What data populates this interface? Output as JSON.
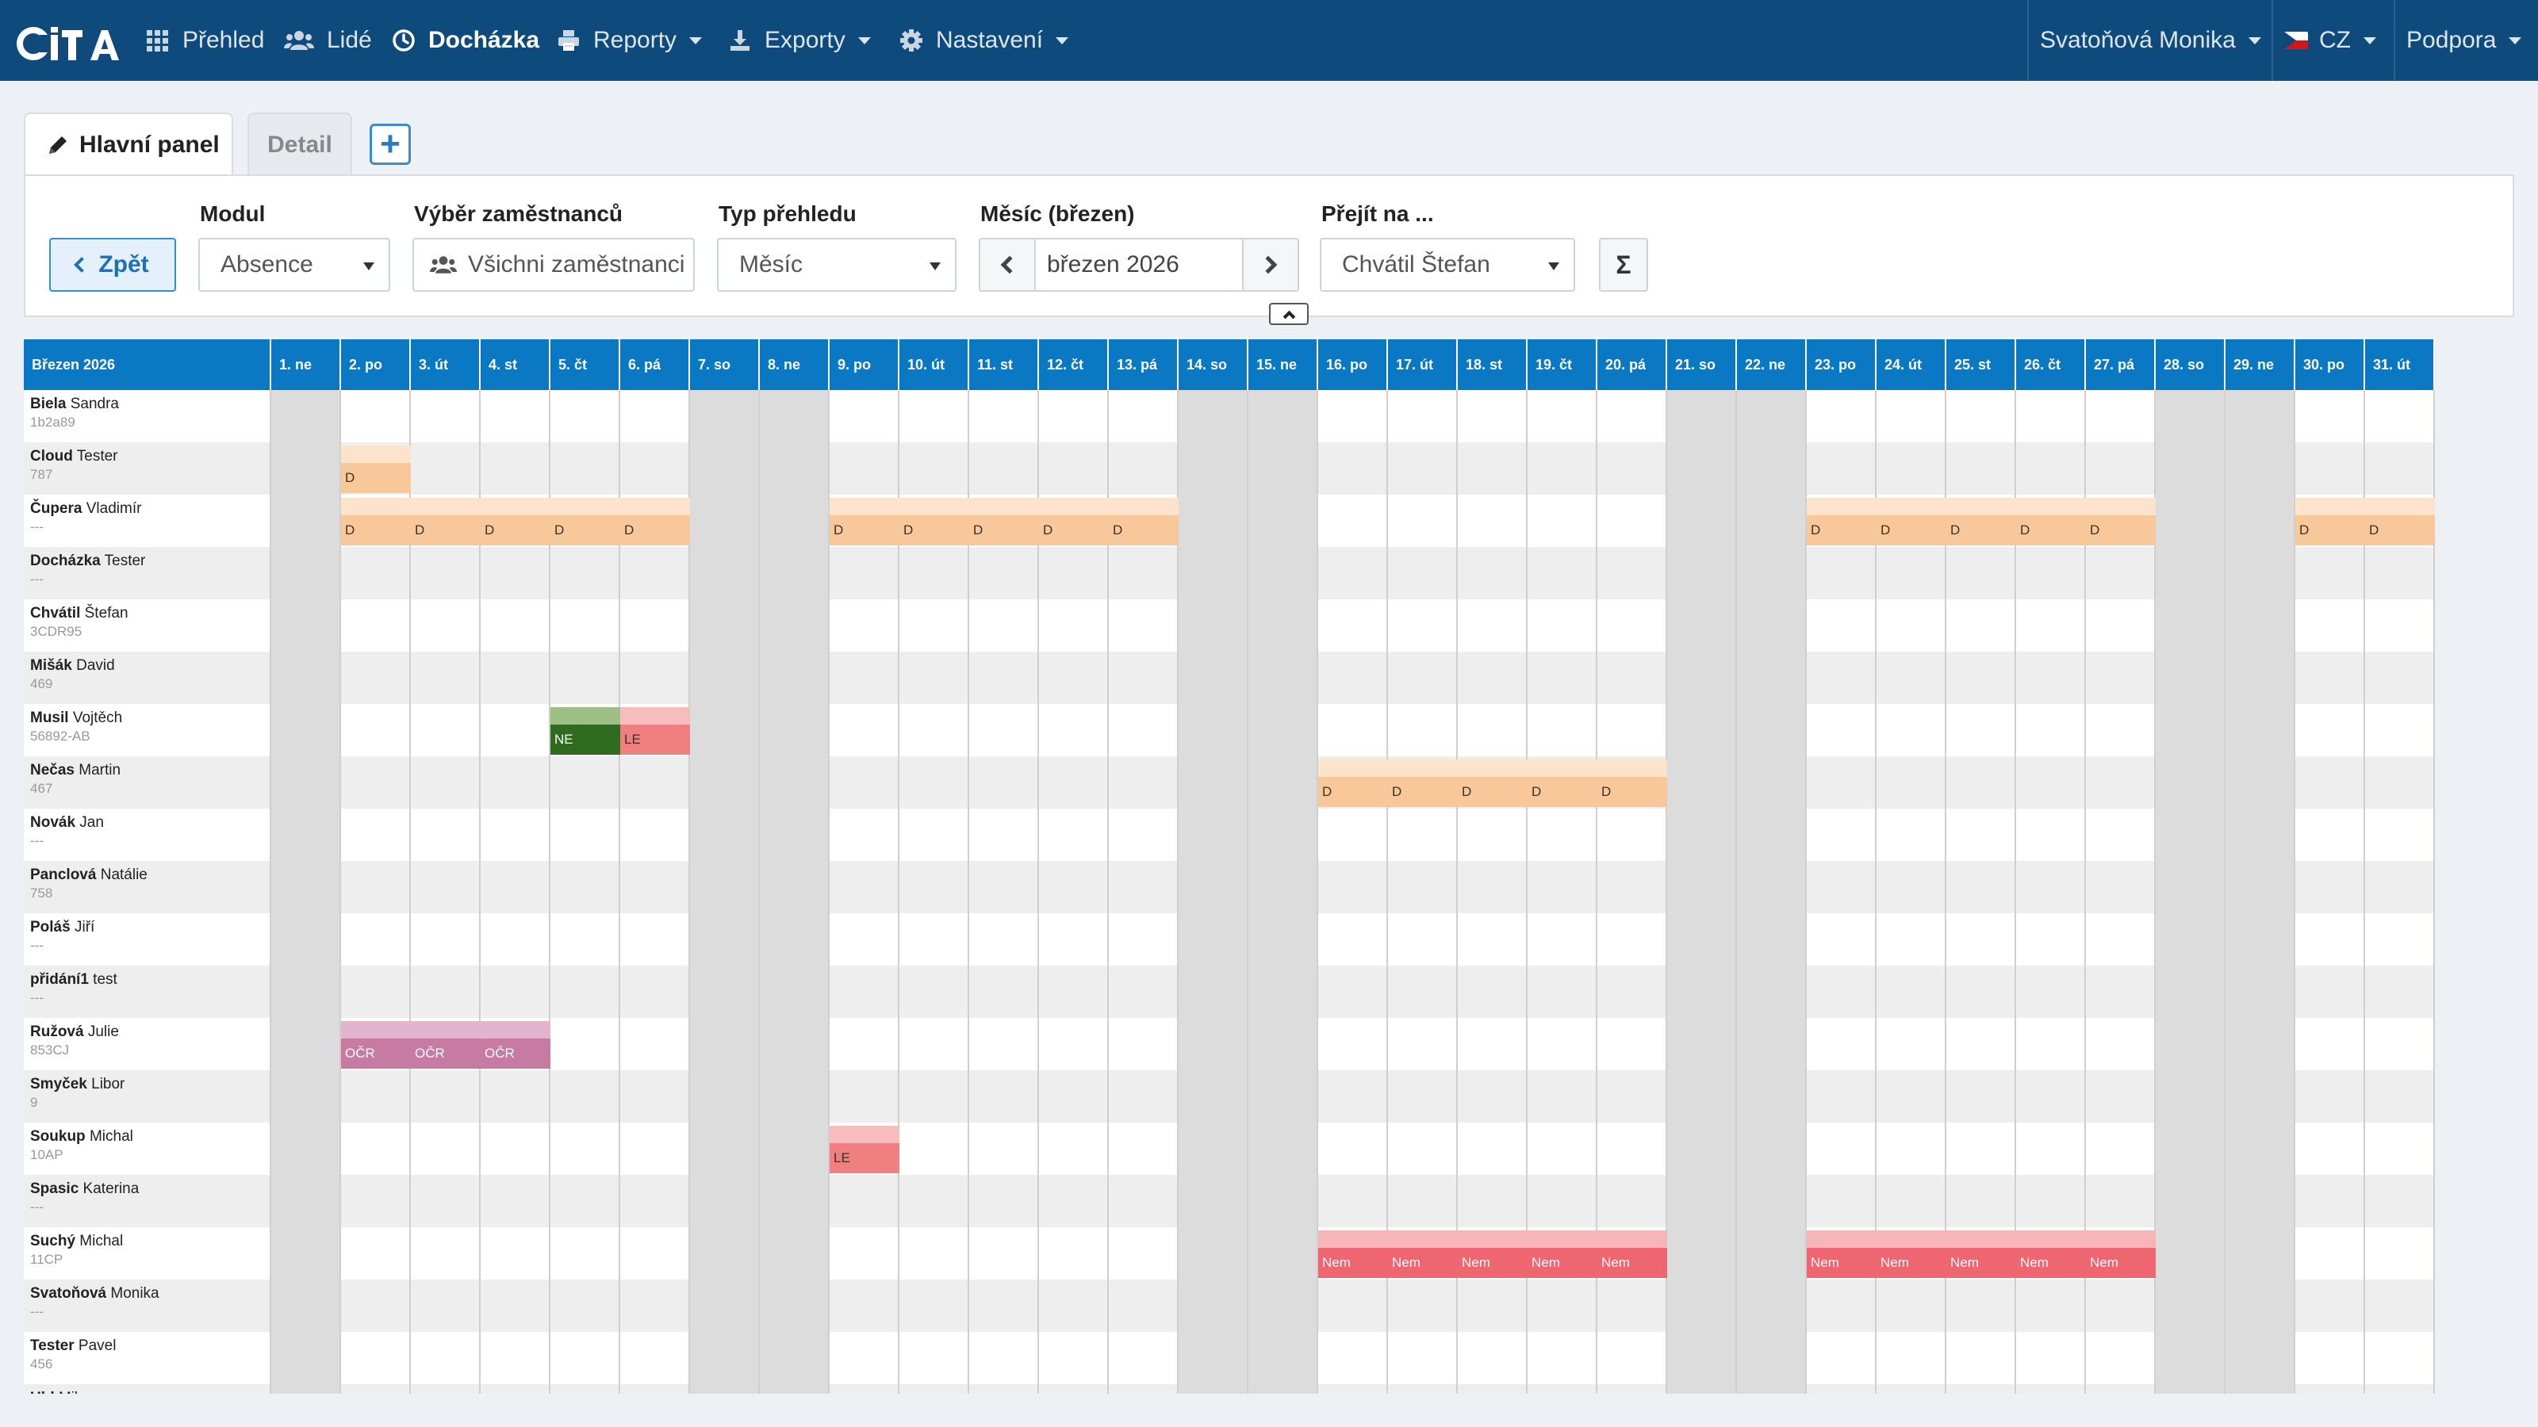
{
  "app": {
    "logo_text": "CITA",
    "brand_color": "#0f4a7c"
  },
  "nav": {
    "items": [
      {
        "label": "Přehled",
        "icon": "grid-icon",
        "active": false,
        "dropdown": false
      },
      {
        "label": "Lidé",
        "icon": "users-icon",
        "active": false,
        "dropdown": false
      },
      {
        "label": "Docházka",
        "icon": "clock-icon",
        "active": true,
        "dropdown": false
      },
      {
        "label": "Reporty",
        "icon": "print-icon",
        "active": false,
        "dropdown": true
      },
      {
        "label": "Exporty",
        "icon": "export-icon",
        "active": false,
        "dropdown": true
      },
      {
        "label": "Nastavení",
        "icon": "gear-icon",
        "active": false,
        "dropdown": true
      }
    ],
    "user": "Svatoňová Monika",
    "language": "CZ",
    "support": "Podpora"
  },
  "tabs": {
    "main": "Hlavní panel",
    "detail": "Detail",
    "add": "+"
  },
  "filters": {
    "back": "Zpět",
    "module_label": "Modul",
    "module_value": "Absence",
    "employees_label": "Výběr zaměstnanců",
    "employees_value": "Všichni zaměstnanci",
    "view_label": "Typ přehledu",
    "view_value": "Měsíc",
    "month_label": "Měsíc (březen)",
    "month_value": "březen 2026",
    "goto_label": "Přejít na ...",
    "goto_value": "Chvátil Štefan",
    "sum_button": "Σ"
  },
  "calendar": {
    "title": "Březen 2026",
    "days": [
      {
        "label": "1. ne",
        "weekend": true
      },
      {
        "label": "2. po",
        "weekend": false
      },
      {
        "label": "3. út",
        "weekend": false
      },
      {
        "label": "4. st",
        "weekend": false
      },
      {
        "label": "5. čt",
        "weekend": false
      },
      {
        "label": "6. pá",
        "weekend": false
      },
      {
        "label": "7. so",
        "weekend": true
      },
      {
        "label": "8. ne",
        "weekend": true
      },
      {
        "label": "9. po",
        "weekend": false
      },
      {
        "label": "10. út",
        "weekend": false
      },
      {
        "label": "11. st",
        "weekend": false
      },
      {
        "label": "12. čt",
        "weekend": false
      },
      {
        "label": "13. pá",
        "weekend": false
      },
      {
        "label": "14. so",
        "weekend": true
      },
      {
        "label": "15. ne",
        "weekend": true
      },
      {
        "label": "16. po",
        "weekend": false
      },
      {
        "label": "17. út",
        "weekend": false
      },
      {
        "label": "18. st",
        "weekend": false
      },
      {
        "label": "19. čt",
        "weekend": false
      },
      {
        "label": "20. pá",
        "weekend": false
      },
      {
        "label": "21. so",
        "weekend": true
      },
      {
        "label": "22. ne",
        "weekend": true
      },
      {
        "label": "23. po",
        "weekend": false
      },
      {
        "label": "24. út",
        "weekend": false
      },
      {
        "label": "25. st",
        "weekend": false
      },
      {
        "label": "26. čt",
        "weekend": false
      },
      {
        "label": "27. pá",
        "weekend": false
      },
      {
        "label": "28. so",
        "weekend": true
      },
      {
        "label": "29. ne",
        "weekend": true
      },
      {
        "label": "30. po",
        "weekend": false
      },
      {
        "label": "31. út",
        "weekend": false
      }
    ],
    "absence_types": {
      "D": {
        "top": "#fbe3cc",
        "bottom": "#f8c89a",
        "text": "#333333"
      },
      "NE": {
        "top": "#9dbf86",
        "bottom": "#2e6b1e",
        "text": "#ffffff"
      },
      "LE": {
        "top": "#f7bcbc",
        "bottom": "#f07f80",
        "text": "#333333"
      },
      "OČR": {
        "top": "#e2b4cd",
        "bottom": "#c77aa2",
        "text": "#ffffff"
      },
      "Nem": {
        "top": "#f5b5b9",
        "bottom": "#ee6670",
        "text": "#ffffff"
      }
    },
    "employees": [
      {
        "surname": "Biela",
        "firstname": "Sandra",
        "code": "1b2a89",
        "absences": []
      },
      {
        "surname": "Cloud",
        "firstname": "Tester",
        "code": "787",
        "absences": [
          {
            "day": 2,
            "type": "D"
          }
        ]
      },
      {
        "surname": "Čupera",
        "firstname": "Vladimír",
        "code": "---",
        "absences": [
          {
            "day": 2,
            "type": "D"
          },
          {
            "day": 3,
            "type": "D"
          },
          {
            "day": 4,
            "type": "D"
          },
          {
            "day": 5,
            "type": "D"
          },
          {
            "day": 6,
            "type": "D"
          },
          {
            "day": 9,
            "type": "D"
          },
          {
            "day": 10,
            "type": "D"
          },
          {
            "day": 11,
            "type": "D"
          },
          {
            "day": 12,
            "type": "D"
          },
          {
            "day": 13,
            "type": "D"
          },
          {
            "day": 23,
            "type": "D"
          },
          {
            "day": 24,
            "type": "D"
          },
          {
            "day": 25,
            "type": "D"
          },
          {
            "day": 26,
            "type": "D"
          },
          {
            "day": 27,
            "type": "D"
          },
          {
            "day": 30,
            "type": "D"
          },
          {
            "day": 31,
            "type": "D"
          }
        ]
      },
      {
        "surname": "Docházka",
        "firstname": "Tester",
        "code": "---",
        "absences": []
      },
      {
        "surname": "Chvátil",
        "firstname": "Štefan",
        "code": "3CDR95",
        "absences": []
      },
      {
        "surname": "Mišák",
        "firstname": "David",
        "code": "469",
        "absences": []
      },
      {
        "surname": "Musil",
        "firstname": "Vojtěch",
        "code": "56892-AB",
        "absences": [
          {
            "day": 5,
            "type": "NE"
          },
          {
            "day": 6,
            "type": "LE"
          }
        ]
      },
      {
        "surname": "Nečas",
        "firstname": "Martin",
        "code": "467",
        "absences": [
          {
            "day": 16,
            "type": "D"
          },
          {
            "day": 17,
            "type": "D"
          },
          {
            "day": 18,
            "type": "D"
          },
          {
            "day": 19,
            "type": "D"
          },
          {
            "day": 20,
            "type": "D"
          }
        ]
      },
      {
        "surname": "Novák",
        "firstname": "Jan",
        "code": "---",
        "absences": []
      },
      {
        "surname": "Panclová",
        "firstname": "Natálie",
        "code": "758",
        "absences": []
      },
      {
        "surname": "Poláš",
        "firstname": "Jiří",
        "code": "---",
        "absences": []
      },
      {
        "surname": "přidání1",
        "firstname": "test",
        "code": "---",
        "absences": []
      },
      {
        "surname": "Ružová",
        "firstname": "Julie",
        "code": "853CJ",
        "absences": [
          {
            "day": 2,
            "type": "OČR"
          },
          {
            "day": 3,
            "type": "OČR"
          },
          {
            "day": 4,
            "type": "OČR"
          }
        ]
      },
      {
        "surname": "Smyček",
        "firstname": "Libor",
        "code": "9",
        "absences": []
      },
      {
        "surname": "Soukup",
        "firstname": "Michal",
        "code": "10AP",
        "absences": [
          {
            "day": 9,
            "type": "LE"
          }
        ]
      },
      {
        "surname": "Spasic",
        "firstname": "Katerina",
        "code": "---",
        "absences": []
      },
      {
        "surname": "Suchý",
        "firstname": "Michal",
        "code": "11CP",
        "absences": [
          {
            "day": 16,
            "type": "Nem"
          },
          {
            "day": 17,
            "type": "Nem"
          },
          {
            "day": 18,
            "type": "Nem"
          },
          {
            "day": 19,
            "type": "Nem"
          },
          {
            "day": 20,
            "type": "Nem"
          },
          {
            "day": 23,
            "type": "Nem"
          },
          {
            "day": 24,
            "type": "Nem"
          },
          {
            "day": 25,
            "type": "Nem"
          },
          {
            "day": 26,
            "type": "Nem"
          },
          {
            "day": 27,
            "type": "Nem"
          }
        ]
      },
      {
        "surname": "Svatoňová",
        "firstname": "Monika",
        "code": "---",
        "absences": []
      },
      {
        "surname": "Tester",
        "firstname": "Pavel",
        "code": "456",
        "absences": []
      },
      {
        "surname": "Uhl",
        "firstname": "Milan",
        "code": "",
        "absences": []
      }
    ]
  }
}
